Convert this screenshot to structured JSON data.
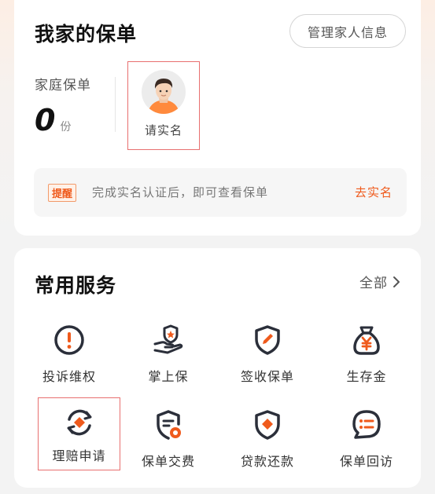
{
  "policy_card": {
    "title": "我家的保单",
    "manage_button": "管理家人信息",
    "family_label": "家庭保单",
    "count": "0",
    "count_unit": "份",
    "member_label": "请实名",
    "notice": {
      "tag": "提醒",
      "text": "完成实名认证后，即可查看保单",
      "link": "去实名"
    }
  },
  "services_card": {
    "title": "常用服务",
    "all_link": "全部",
    "items": [
      {
        "label": "投诉维权",
        "icon": "exclamation-circle-icon"
      },
      {
        "label": "掌上保",
        "icon": "hand-shield-icon"
      },
      {
        "label": "签收保单",
        "icon": "shield-pen-icon"
      },
      {
        "label": "生存金",
        "icon": "money-bag-icon"
      },
      {
        "label": "理赔申请",
        "icon": "claim-cycle-icon"
      },
      {
        "label": "保单交费",
        "icon": "document-pay-icon"
      },
      {
        "label": "贷款还款",
        "icon": "shield-loan-icon"
      },
      {
        "label": "保单回访",
        "icon": "chat-list-icon"
      }
    ]
  },
  "colors": {
    "accent": "#ef5a1c",
    "icon_dark": "#2b2f3a",
    "highlight_border": "#e86f6f"
  }
}
